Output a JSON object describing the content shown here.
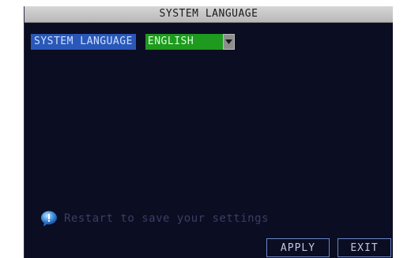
{
  "window": {
    "title": "SYSTEM LANGUAGE"
  },
  "language": {
    "label": "SYSTEM LANGUAGE",
    "selected": "ENGLISH"
  },
  "hint": {
    "icon": "info-icon",
    "text": "Restart to save your settings"
  },
  "buttons": {
    "apply_label": "APPLY",
    "exit_label": "EXIT"
  },
  "colors": {
    "title_bar": "#c4c4c4",
    "background": "#0b0d22",
    "label_highlight": "#2a58b8",
    "select_highlight": "#1e9a1e",
    "button_border": "#6a86c6"
  }
}
